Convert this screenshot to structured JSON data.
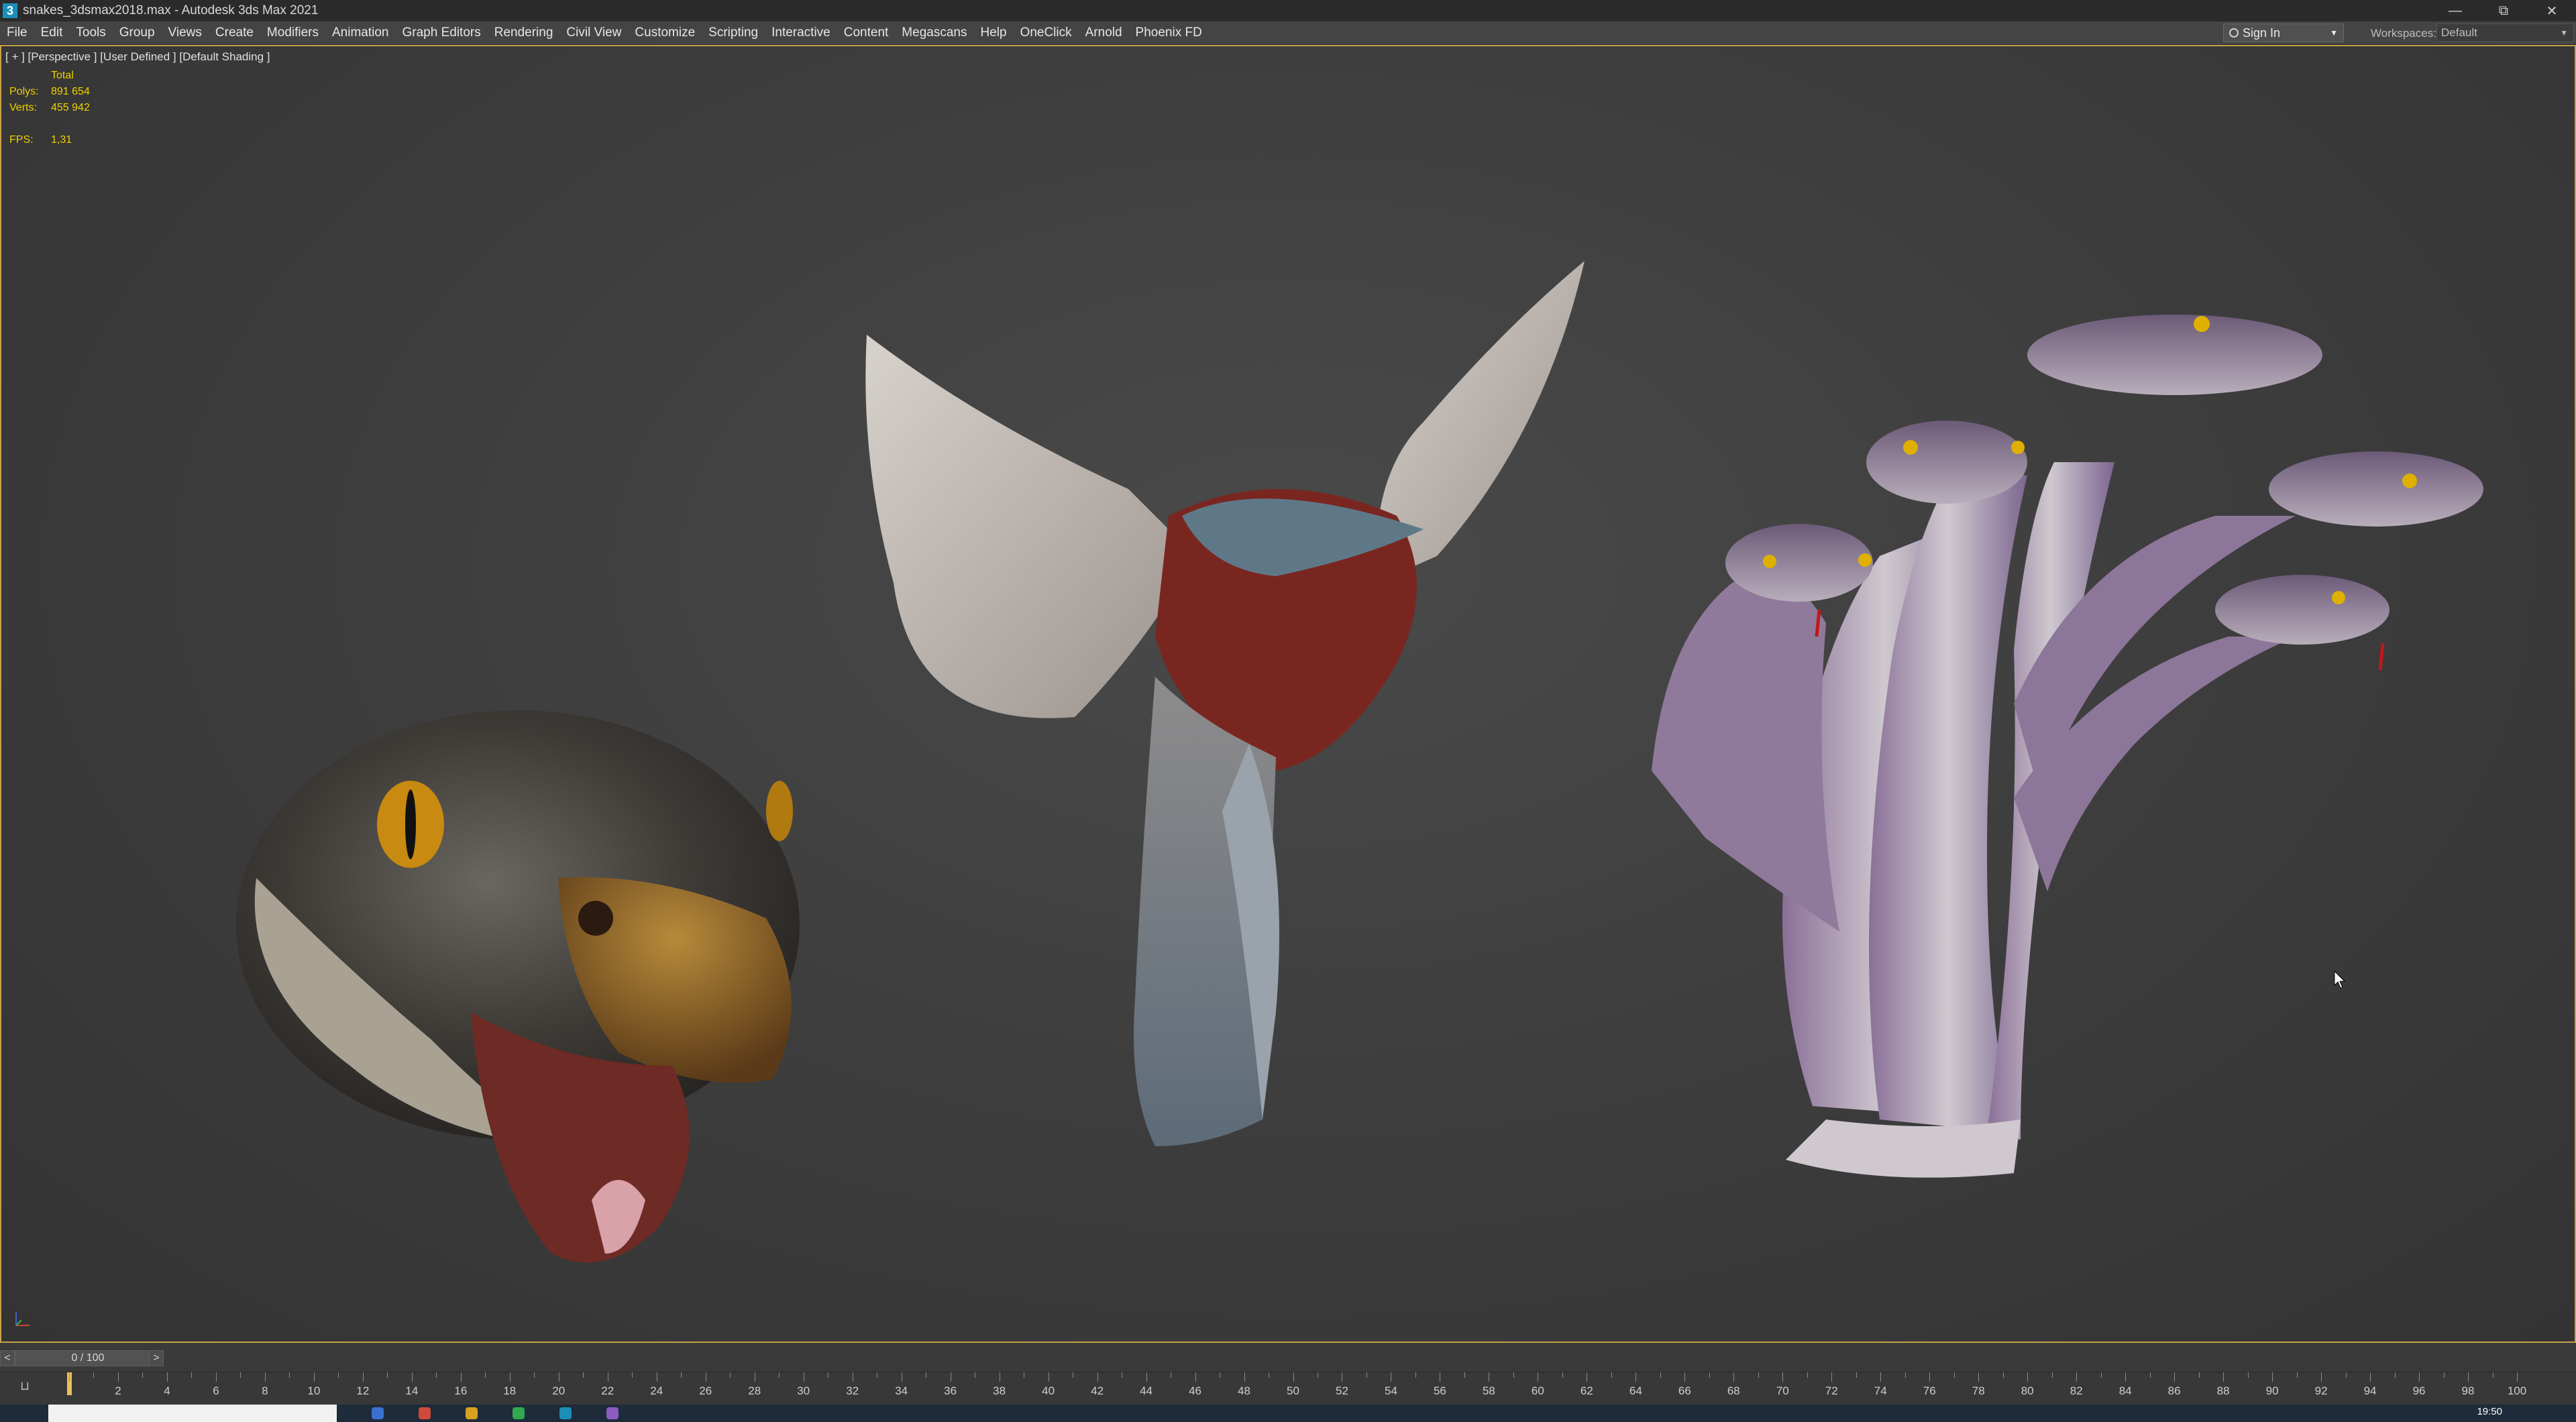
{
  "window": {
    "title": "snakes_3dsmax2018.max - Autodesk 3ds Max 2021",
    "app_icon_letter": "3"
  },
  "menu": [
    "File",
    "Edit",
    "Tools",
    "Group",
    "Views",
    "Create",
    "Modifiers",
    "Animation",
    "Graph Editors",
    "Rendering",
    "Civil View",
    "Customize",
    "Scripting",
    "Interactive",
    "Content",
    "Megascans",
    "Help",
    "OneClick",
    "Arnold",
    "Phoenix FD"
  ],
  "account": {
    "sign_in": "Sign In"
  },
  "workspaces": {
    "label": "Workspaces:",
    "value": "Default"
  },
  "viewport": {
    "label": "[ + ] [Perspective ] [User Defined ] [Default Shading ]",
    "stats_header": "Total",
    "polys_label": "Polys:",
    "polys_value": "891 654",
    "verts_label": "Verts:",
    "verts_value": "455 942",
    "fps_label": "FPS:",
    "fps_value": "1,31"
  },
  "time_slider": {
    "value": "0 / 100",
    "prev": "<",
    "next": ">"
  },
  "trackbar": {
    "ticks": [
      "2",
      "4",
      "6",
      "8",
      "10",
      "12",
      "14",
      "16",
      "18",
      "20",
      "22",
      "24",
      "26",
      "28",
      "30",
      "32",
      "34",
      "36",
      "38",
      "40",
      "42",
      "44",
      "46",
      "48",
      "50",
      "52",
      "54",
      "56",
      "58",
      "60",
      "62",
      "64",
      "66",
      "68",
      "70",
      "72",
      "74",
      "76",
      "78",
      "80",
      "82",
      "84",
      "86",
      "88",
      "90",
      "92",
      "94",
      "96",
      "98",
      "100"
    ]
  },
  "taskbar": {
    "clock": "19:50"
  },
  "colors": {
    "viewport_border": "#c8a24a",
    "stats_text": "#f0d000",
    "frame_marker": "#e8c25a"
  }
}
